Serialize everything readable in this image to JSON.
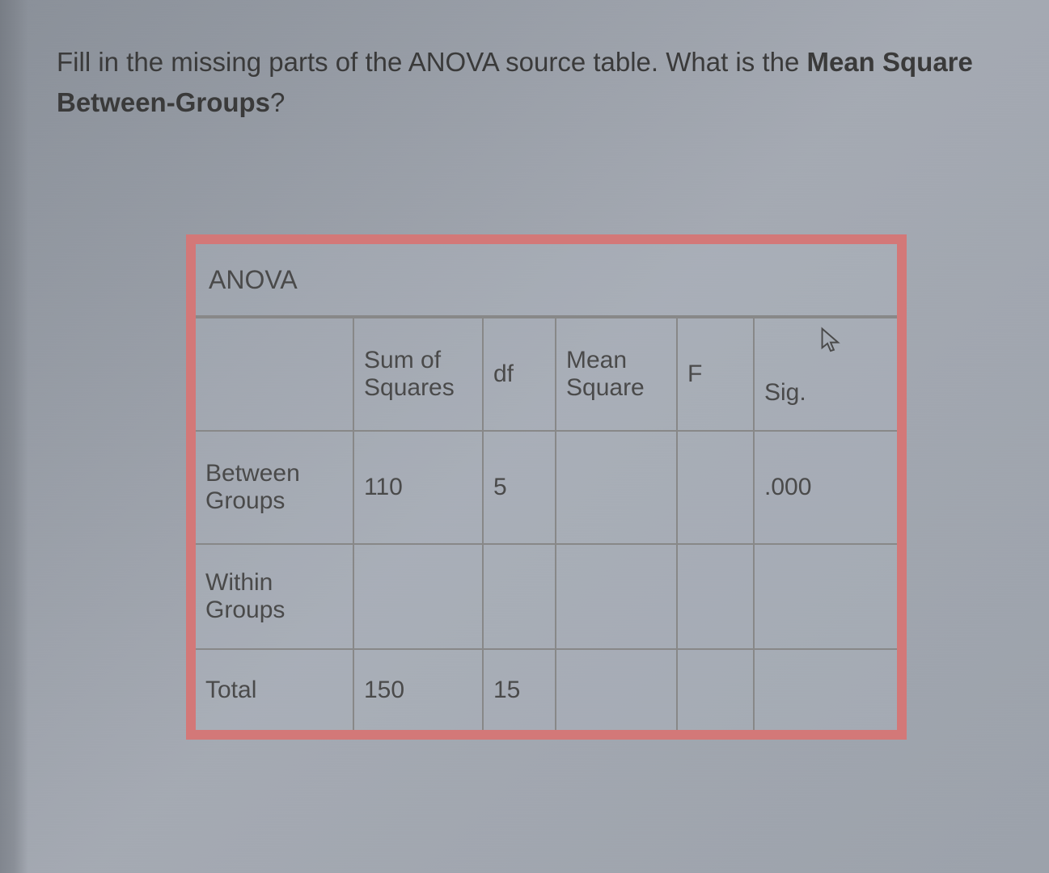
{
  "question": {
    "part1": "Fill in the missing parts of the ANOVA source table. What is the ",
    "bold": "Mean Square Between-Groups",
    "part2": "?"
  },
  "table": {
    "title": "ANOVA",
    "headers": {
      "rowheader": "",
      "ss": "Sum of Squares",
      "df": "df",
      "ms": "Mean Square",
      "f": "F",
      "sig": "Sig."
    },
    "rows": {
      "between": {
        "label": "Between Groups",
        "ss": "110",
        "df": "5",
        "ms": "",
        "f": "",
        "sig": ".000"
      },
      "within": {
        "label": "Within Groups",
        "ss": "",
        "df": "",
        "ms": "",
        "f": "",
        "sig": ""
      },
      "total": {
        "label": "Total",
        "ss": "150",
        "df": "15",
        "ms": "",
        "f": "",
        "sig": ""
      }
    }
  },
  "chart_data": {
    "type": "table",
    "title": "ANOVA",
    "columns": [
      "",
      "Sum of Squares",
      "df",
      "Mean Square",
      "F",
      "Sig."
    ],
    "rows": [
      [
        "Between Groups",
        110,
        5,
        null,
        null,
        0.0
      ],
      [
        "Within Groups",
        null,
        null,
        null,
        null,
        null
      ],
      [
        "Total",
        150,
        15,
        null,
        null,
        null
      ]
    ]
  }
}
